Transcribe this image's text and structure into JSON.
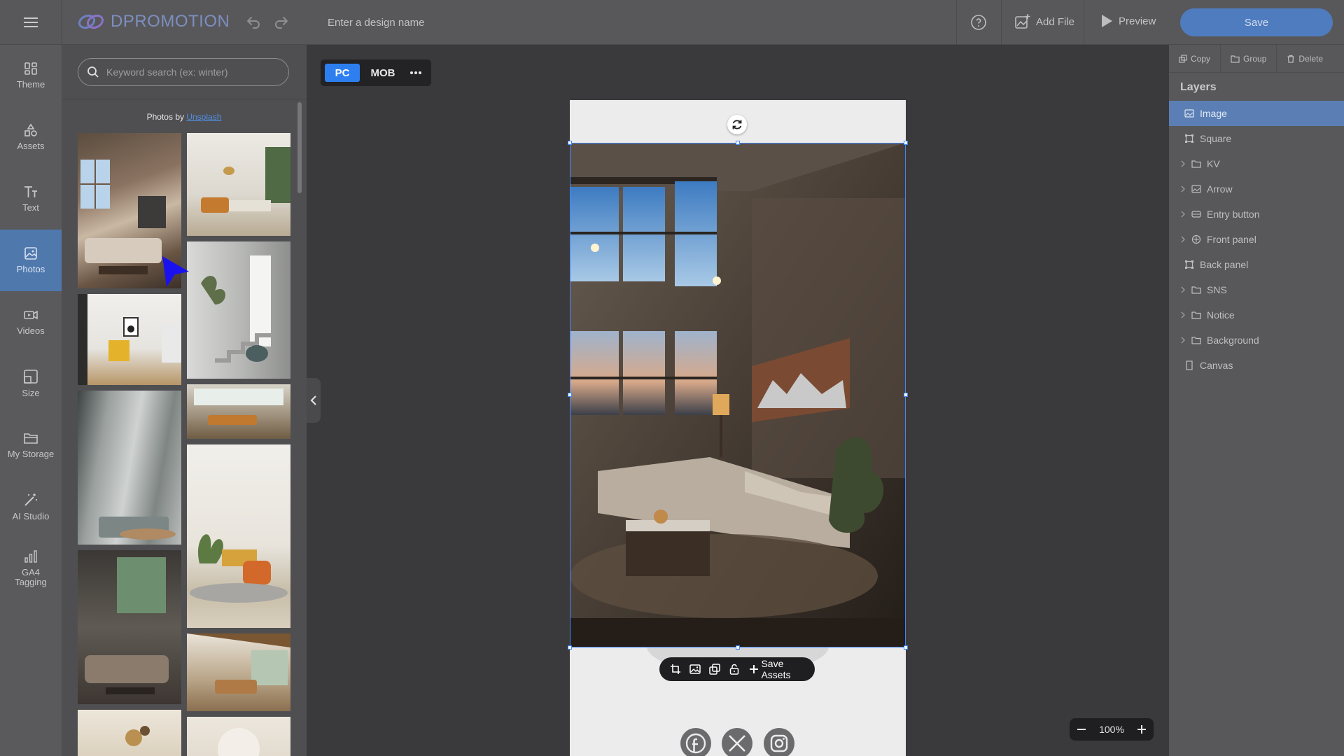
{
  "app": {
    "logo_text": "DPROMOTION"
  },
  "topbar": {
    "design_name_placeholder": "Enter a design name",
    "add_file_label": "Add File",
    "preview_label": "Preview",
    "save_label": "Save"
  },
  "rail": {
    "items": [
      {
        "label": "Theme",
        "icon": "theme-icon"
      },
      {
        "label": "Assets",
        "icon": "assets-icon"
      },
      {
        "label": "Text",
        "icon": "text-icon"
      },
      {
        "label": "Photos",
        "icon": "photos-icon",
        "active": true
      },
      {
        "label": "Videos",
        "icon": "videos-icon"
      },
      {
        "label": "Size",
        "icon": "size-icon"
      },
      {
        "label": "My Storage",
        "icon": "folder-icon"
      },
      {
        "label": "AI Studio",
        "icon": "magic-wand-icon"
      },
      {
        "label": "GA4 Tagging",
        "icon": "bar-chart-icon"
      }
    ]
  },
  "photos_panel": {
    "search_placeholder": "Keyword search (ex: winter)",
    "credit_prefix": "Photos by",
    "credit_link": "Unsplash"
  },
  "canvas": {
    "device_pc": "PC",
    "device_mob": "MOB",
    "save_assets_label": "Save Assets",
    "zoom_level": "100%"
  },
  "right_panel": {
    "actions": [
      "Copy",
      "Group",
      "Delete"
    ],
    "layers_title": "Layers",
    "layers": [
      {
        "label": "Image",
        "icon": "image-icon",
        "expandable": false,
        "selected": true
      },
      {
        "label": "Square",
        "icon": "square-icon",
        "expandable": false
      },
      {
        "label": "KV",
        "icon": "folder-icon",
        "expandable": true
      },
      {
        "label": "Arrow",
        "icon": "image-icon",
        "expandable": true
      },
      {
        "label": "Entry button",
        "icon": "button-icon",
        "expandable": true
      },
      {
        "label": "Front panel",
        "icon": "target-icon",
        "expandable": true
      },
      {
        "label": "Back panel",
        "icon": "square-icon",
        "expandable": false
      },
      {
        "label": "SNS",
        "icon": "folder-icon",
        "expandable": true
      },
      {
        "label": "Notice",
        "icon": "folder-icon",
        "expandable": true
      },
      {
        "label": "Background",
        "icon": "folder-icon",
        "expandable": true
      },
      {
        "label": "Canvas",
        "icon": "canvas-icon",
        "expandable": false
      }
    ]
  }
}
